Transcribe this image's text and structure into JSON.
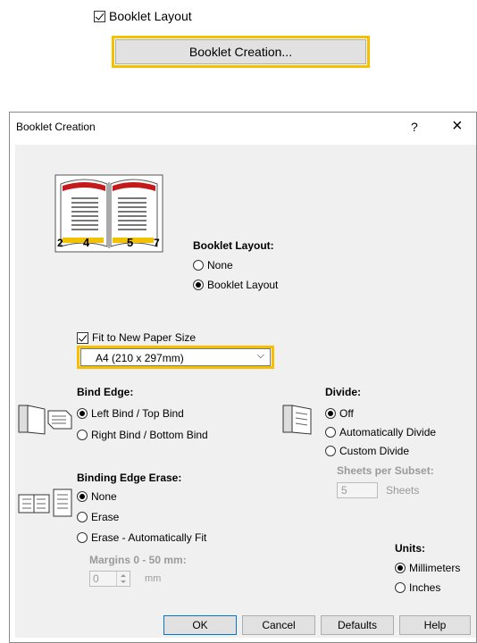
{
  "top": {
    "checkbox_label": "Booklet Layout",
    "button_label": "Booklet Creation..."
  },
  "dialog": {
    "title": "Booklet Creation",
    "help_glyph": "?",
    "close_glyph": "×",
    "booklet_layout": {
      "heading": "Booklet Layout:",
      "options": [
        "None",
        "Booklet Layout"
      ],
      "selected": "Booklet Layout"
    },
    "fit_to_new": {
      "label": "Fit to New Paper Size",
      "checked": true,
      "paper_size": "A4 (210 x 297mm)"
    },
    "bind_edge": {
      "heading": "Bind Edge:",
      "options": [
        "Left Bind / Top Bind",
        "Right Bind / Bottom Bind"
      ],
      "selected": "Left Bind / Top Bind"
    },
    "divide": {
      "heading": "Divide:",
      "options": [
        "Off",
        "Automatically Divide",
        "Custom Divide"
      ],
      "selected": "Off",
      "sheets_per_subset_label": "Sheets per Subset:",
      "sheets_value": "5",
      "sheets_unit": "Sheets"
    },
    "binding_edge_erase": {
      "heading": "Binding Edge Erase:",
      "options": [
        "None",
        "Erase",
        "Erase - Automatically Fit"
      ],
      "selected": "None",
      "margins_label": "Margins 0 - 50 mm:",
      "margin_value": "0",
      "margin_unit": "mm"
    },
    "units": {
      "heading": "Units:",
      "options": [
        "Millimeters",
        "Inches"
      ],
      "selected": "Millimeters"
    },
    "preview_page_numbers": [
      "2",
      "4",
      "5",
      "7"
    ],
    "buttons": {
      "ok": "OK",
      "cancel": "Cancel",
      "defaults": "Defaults",
      "help": "Help"
    },
    "highlight_color": "#f6c000"
  }
}
